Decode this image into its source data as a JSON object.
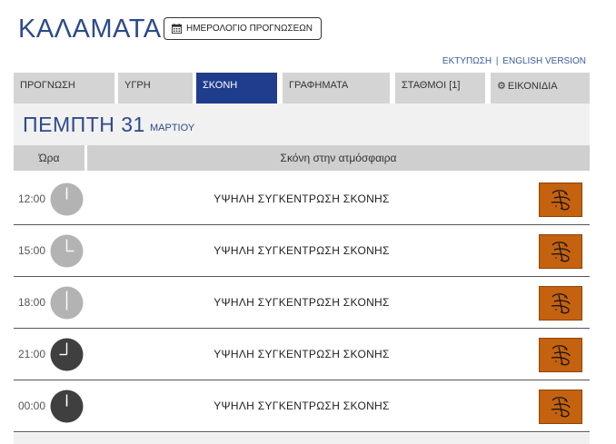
{
  "header": {
    "city": "ΚΑΛΑΜΑΤΑ",
    "calendar_label": "ΗΜΕΡΟΛΟΓΙΟ ΠΡΟΓΝΩΣΕΩΝ",
    "print_link": "ΕΚΤΥΠΩΣΗ",
    "separator": "|",
    "english_link": "ENGLISH VERSION"
  },
  "tabs": [
    {
      "label": "ΠΡΟΓΝΩΣΗ"
    },
    {
      "label": "ΥΓΡΗ"
    },
    {
      "label": "ΣΚΟΝΗ"
    },
    {
      "label": "ΓΡΑΦΗΜΑΤΑ"
    },
    {
      "label": "ΣΤΑΘΜΟΙ [1]"
    },
    {
      "label": "ΕΙΚΟΝΙΔΙΑ"
    }
  ],
  "active_tab": "ΣΚΟΝΗ",
  "day": {
    "title": "ΠΕΜΠΤΗ 31",
    "month": "ΜΑΡΤΙΟΥ"
  },
  "table": {
    "col_hour": "Ώρα",
    "col_dust": "Σκόνη στην ατμόσφαιρα"
  },
  "rows": [
    {
      "time": "12:00",
      "desc": "ΥΨΗΛΗ ΣΥΓΚΕΝΤΡΩΣΗ ΣΚΟΝΗΣ",
      "night": false
    },
    {
      "time": "15:00",
      "desc": "ΥΨΗΛΗ ΣΥΓΚΕΝΤΡΩΣΗ ΣΚΟΝΗΣ",
      "night": false
    },
    {
      "time": "18:00",
      "desc": "ΥΨΗΛΗ ΣΥΓΚΕΝΤΡΩΣΗ ΣΚΟΝΗΣ",
      "night": false
    },
    {
      "time": "21:00",
      "desc": "ΥΨΗΛΗ ΣΥΓΚΕΝΤΡΩΣΗ ΣΚΟΝΗΣ",
      "night": true
    },
    {
      "time": "00:00",
      "desc": "ΥΨΗΛΗ ΣΥΓΚΕΝΤΡΩΣΗ ΣΚΟΝΗΣ",
      "night": true
    }
  ],
  "colors": {
    "brand_blue": "#2d4a8a",
    "active_tab": "#1f3d8c",
    "dust_icon_bg": "#c4620f",
    "clock_day": "#b3b3b3",
    "clock_night": "#3f3f3f"
  }
}
